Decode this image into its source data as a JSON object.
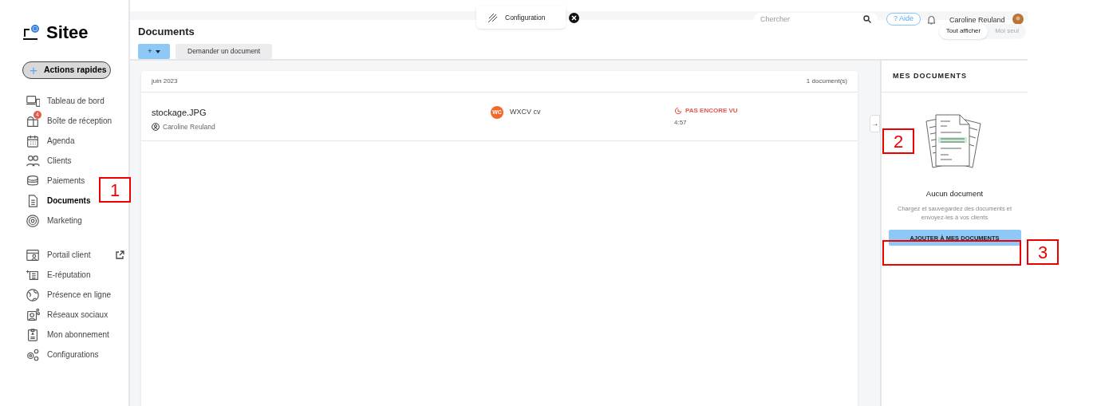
{
  "brand": {
    "name": "Sitee"
  },
  "quick_actions": {
    "label": "Actions rapides",
    "icon": "+"
  },
  "sidebar": {
    "items": [
      {
        "label": "Tableau de bord",
        "selected": false
      },
      {
        "label": "Boîte de réception",
        "selected": false,
        "badge": "4"
      },
      {
        "label": "Agenda",
        "selected": false
      },
      {
        "label": "Clients",
        "selected": false
      },
      {
        "label": "Paiements",
        "selected": false
      },
      {
        "label": "Documents",
        "selected": true
      },
      {
        "label": "Marketing",
        "selected": false
      }
    ],
    "items_2": [
      {
        "label": "Portail client",
        "external": true
      },
      {
        "label": "E-réputation",
        "external": false
      },
      {
        "label": "Présence en ligne",
        "external": false
      },
      {
        "label": "Réseaux sociaux",
        "external": false
      },
      {
        "label": "Mon abonnement",
        "external": false
      },
      {
        "label": "Configurations",
        "external": false
      }
    ]
  },
  "top_bar": {
    "config_tab": "Configuration",
    "search": {
      "placeholder": "Chercher"
    },
    "help": "? Aide",
    "user": "Caroline Reuland"
  },
  "page": {
    "title": "Documents",
    "add_button": "+",
    "request_button": "Demander un document",
    "filters": [
      {
        "label": "Tout afficher",
        "selected": true
      },
      {
        "label": "Moi seul",
        "selected": false
      }
    ]
  },
  "document_group": {
    "month": "juin 2023",
    "count": "1 document(s)",
    "rows": [
      {
        "file": "stockage.JPG",
        "owner": "Caroline Reuland",
        "client_initials": "WC",
        "client": "WXCV cv",
        "status": "PAS ENCORE VU",
        "time": "4:57"
      }
    ]
  },
  "side_panel": {
    "title": "MES DOCUMENTS",
    "toggle": "→",
    "empty_title": "Aucun document",
    "empty_text": "Chargez et sauvegardez des documents et envoyez-les à vos clients",
    "button": "AJOUTER À MES DOCUMENTS"
  },
  "annotations": [
    "1",
    "2",
    "3"
  ]
}
